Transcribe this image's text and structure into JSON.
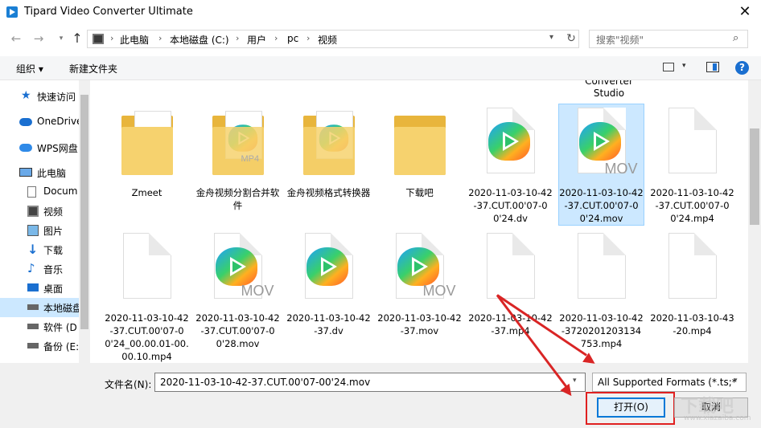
{
  "window": {
    "title": "Tipard Video Converter Ultimate",
    "close_glyph": "✕"
  },
  "nav": {
    "back_glyph": "←",
    "forward_glyph": "→",
    "recent_glyph": "▾",
    "up_glyph": "↑",
    "breadcrumb": [
      "此电脑",
      "本地磁盘 (C:)",
      "用户",
      "pc",
      "视频"
    ],
    "refresh_glyph": "↻",
    "search_placeholder": "搜索\"视频\"",
    "search_glyph": "⌕"
  },
  "toolbar": {
    "organize_label": "组织 ▾",
    "new_folder_label": "新建文件夹",
    "help_label": "?"
  },
  "sidebar": {
    "items": [
      {
        "label": "快速访问",
        "icon": "star-icon"
      },
      {
        "label": "OneDrive",
        "icon": "cloud-icon"
      },
      {
        "label": "WPS网盘",
        "icon": "cloud-icon"
      },
      {
        "label": "此电脑",
        "icon": "computer-icon"
      },
      {
        "label": "Docum",
        "icon": "document-icon"
      },
      {
        "label": "视频",
        "icon": "video-icon"
      },
      {
        "label": "图片",
        "icon": "picture-icon"
      },
      {
        "label": "下载",
        "icon": "download-icon"
      },
      {
        "label": "音乐",
        "icon": "music-icon"
      },
      {
        "label": "桌面",
        "icon": "desktop-icon"
      },
      {
        "label": "本地磁盘",
        "icon": "drive-icon"
      },
      {
        "label": "软件 (D",
        "icon": "drive-icon"
      },
      {
        "label": "备份 (E:",
        "icon": "drive-icon"
      }
    ]
  },
  "files": {
    "cut_top_label": "Converter\nStudio",
    "row1": [
      {
        "name": "Zmeet",
        "kind": "folder"
      },
      {
        "name": "金舟视频分割合并软件",
        "kind": "folder",
        "badge": "MP4"
      },
      {
        "name": "金舟视频格式转换器",
        "kind": "folder"
      },
      {
        "name": "下载吧",
        "kind": "folder"
      },
      {
        "name": "2020-11-03-10-42-37.CUT.00'07-00'24.dv",
        "kind": "video"
      },
      {
        "name": "2020-11-03-10-42-37.CUT.00'07-00'24.mov",
        "kind": "video",
        "badge": "MOV",
        "selected": true
      },
      {
        "name": "2020-11-03-10-42-37.CUT.00'07-00'24.mp4",
        "kind": "blank"
      }
    ],
    "row2": [
      {
        "name": "2020-11-03-10-42-37.CUT.00'07-00'24_00.00.01-00.00.10.mp4",
        "kind": "blank"
      },
      {
        "name": "2020-11-03-10-42-37.CUT.00'07-00'28.mov",
        "kind": "video",
        "badge": "MOV"
      },
      {
        "name": "2020-11-03-10-42-37.dv",
        "kind": "video"
      },
      {
        "name": "2020-11-03-10-42-37.mov",
        "kind": "video",
        "badge": "MOV"
      },
      {
        "name": "2020-11-03-10-42-37.mp4",
        "kind": "blank"
      },
      {
        "name": "2020-11-03-10-42-3720201203134753.mp4",
        "kind": "blank"
      },
      {
        "name": "2020-11-03-10-43-20.mp4",
        "kind": "blank"
      }
    ]
  },
  "bottom": {
    "filename_label": "文件名(N):",
    "filename_value": "2020-11-03-10-42-37.CUT.00'07-00'24.mov",
    "filetype_value": "All Supported Formats (*.ts;*",
    "open_label": "打开(O)",
    "cancel_label": "取消",
    "dropdown_glyph": "⌄"
  },
  "watermark": {
    "main": "下载吧",
    "sub": "www.xiazaiba.com"
  },
  "colors": {
    "selection": "#cce8ff",
    "accent": "#0078d7",
    "highlight_red": "#e02020"
  }
}
